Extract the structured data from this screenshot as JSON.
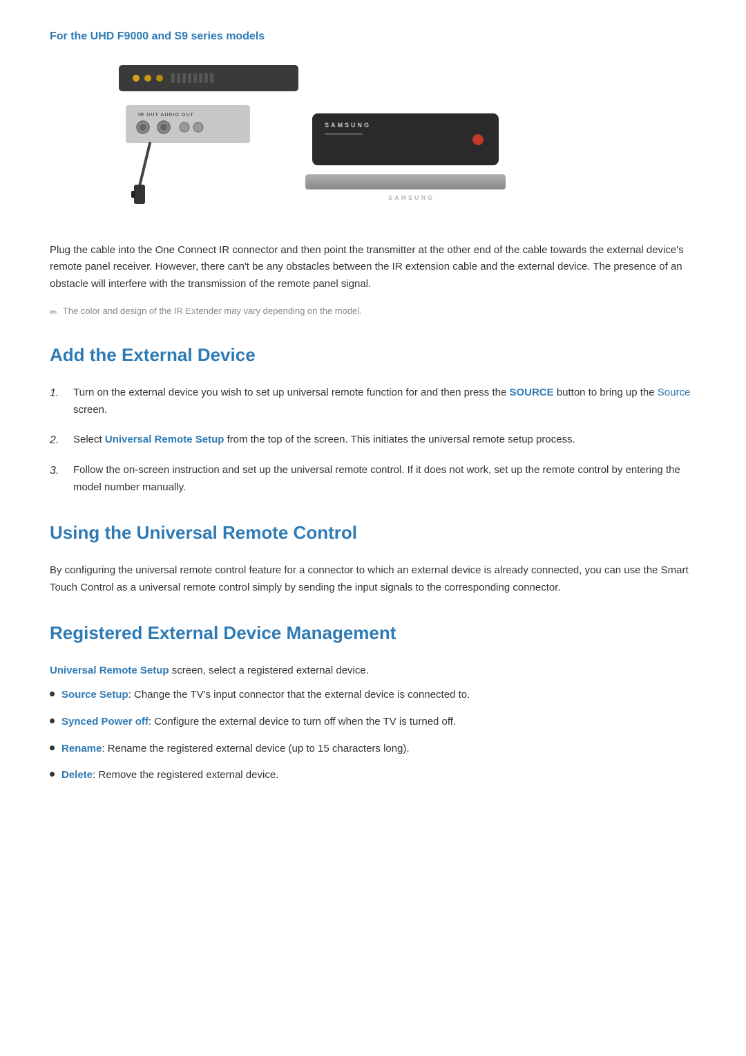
{
  "page": {
    "subtitle": "For the UHD F9000 and S9 series models",
    "intro_paragraph": "Plug the cable into the One Connect IR connector and then point the transmitter at the other end of the cable towards the external device's remote panel receiver. However, there can't be any obstacles between the IR extension cable and the external device. The presence of an obstacle will interfere with the transmission of the remote panel signal.",
    "note": "The color and design of the IR Extender may vary depending on the model.",
    "sections": {
      "add_device": {
        "title": "Add the External Device",
        "steps": [
          {
            "number": "1.",
            "text_before": "Turn on the external device you wish to set up universal remote function for and then press the ",
            "link1": "SOURCE",
            "text_middle": " button to bring up the ",
            "link2": "Source",
            "text_after": " screen."
          },
          {
            "number": "2.",
            "text_before": "Select ",
            "link1": "Universal Remote Setup",
            "text_after": " from the top of the screen. This initiates the universal remote setup process."
          },
          {
            "number": "3.",
            "text": "Follow the on-screen instruction and set up the universal remote control. If it does not work, set up the remote control by entering the model number manually."
          }
        ]
      },
      "using_remote": {
        "title": "Using the Universal Remote Control",
        "body": "By configuring the universal remote control feature for a connector to which an external device is already connected, you can use the Smart Touch Control as a universal remote control simply by sending the input signals to the corresponding connector."
      },
      "registered_management": {
        "title": "Registered External Device Management",
        "intro_before": "",
        "intro_link": "Universal Remote Setup",
        "intro_after": " screen, select a registered external device.",
        "items": [
          {
            "link": "Source Setup",
            "text": ": Change the TV's input connector that the external device is connected to."
          },
          {
            "link": "Synced Power off",
            "text": ": Configure the external device to turn off when the TV is turned off."
          },
          {
            "link": "Rename",
            "text": ": Rename the registered external device (up to 15 characters long)."
          },
          {
            "link": "Delete",
            "text": ": Remove the registered external device."
          }
        ]
      }
    }
  }
}
